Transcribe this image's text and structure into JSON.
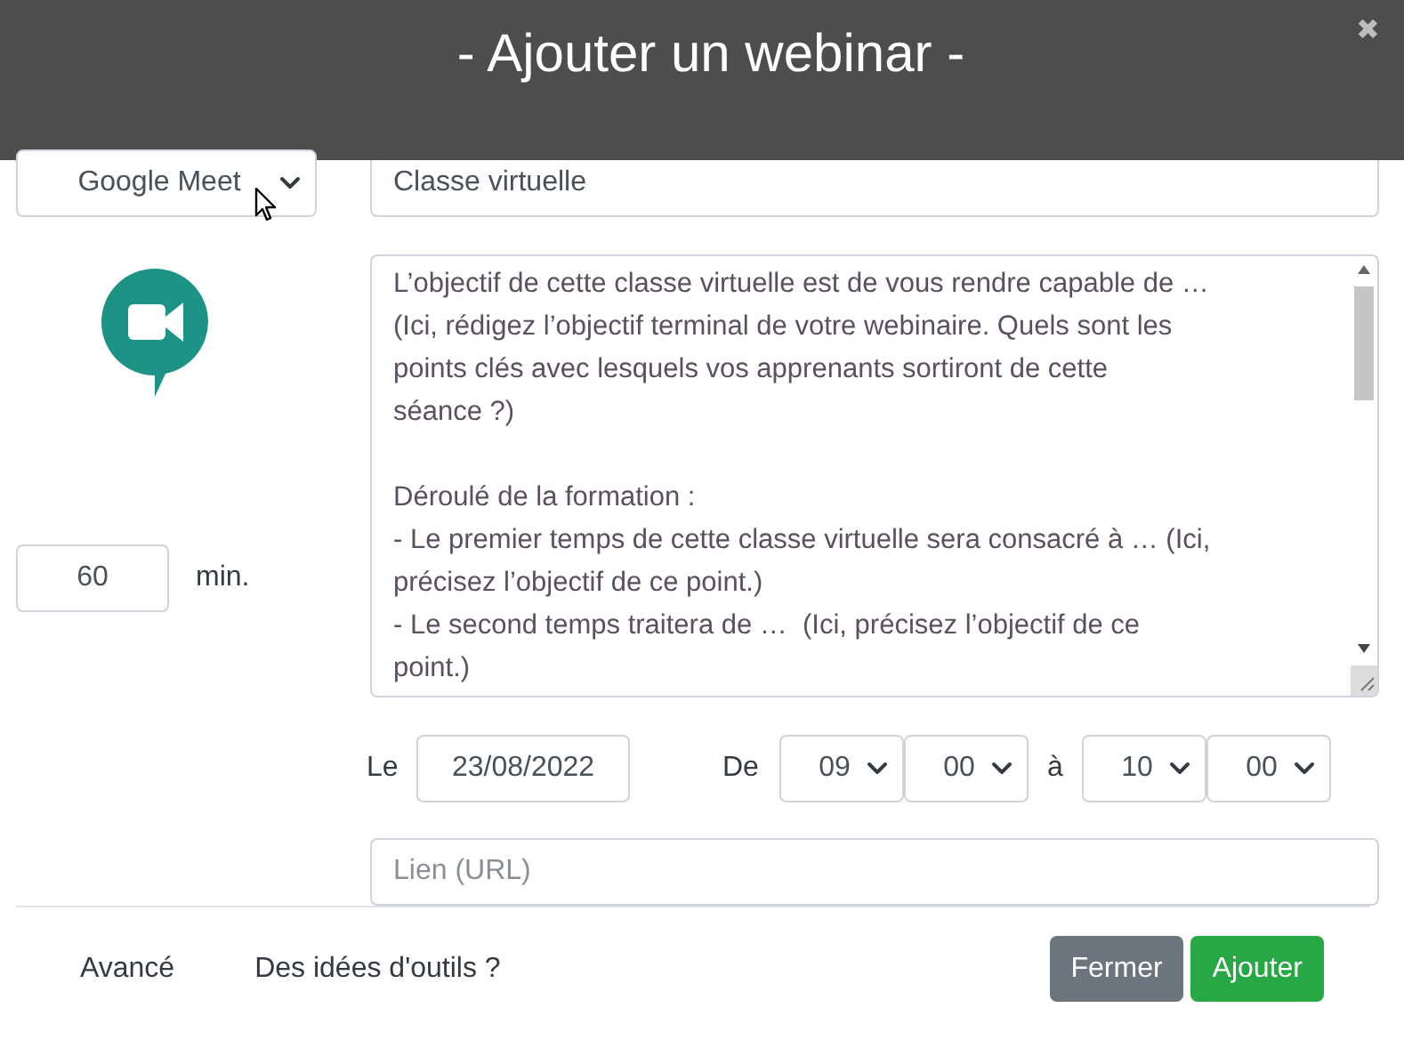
{
  "dialog": {
    "title": "- Ajouter un webinar -",
    "close": "✖"
  },
  "platform_select": {
    "value": "Google Meet"
  },
  "title_field": {
    "value": "Classe virtuelle"
  },
  "duration": {
    "value": "60",
    "unit": "min."
  },
  "description": {
    "paragraphs": [
      {
        "lines": [
          "L’objectif de cette classe virtuelle est de vous rendre capable de …",
          "(Ici, rédigez l’objectif terminal de votre webinaire. Quels sont les",
          "points clés avec lesquels vos apprenants sortiront de cette",
          "séance ?)"
        ]
      },
      {
        "lines": [
          "Déroulé de la formation :",
          "- Le premier temps de cette classe virtuelle sera consacré à … (Ici,",
          "précisez l’objectif de ce point.)",
          "- Le second temps traitera de …  (Ici, précisez l’objectif de ce",
          "point.)"
        ]
      }
    ]
  },
  "schedule": {
    "date_label": "Le",
    "date": "23/08/2022",
    "from_label": "De",
    "from_hour": "09",
    "from_minute": "00",
    "to_label": "à",
    "to_hour": "10",
    "to_minute": "00"
  },
  "url_field": {
    "placeholder": "Lien (URL)"
  },
  "footer": {
    "links": [
      "Avancé",
      "Des idées d'outils ?"
    ],
    "buttons": [
      {
        "label": "Fermer",
        "kind": "secondary"
      },
      {
        "label": "Ajouter",
        "kind": "primary"
      }
    ]
  }
}
